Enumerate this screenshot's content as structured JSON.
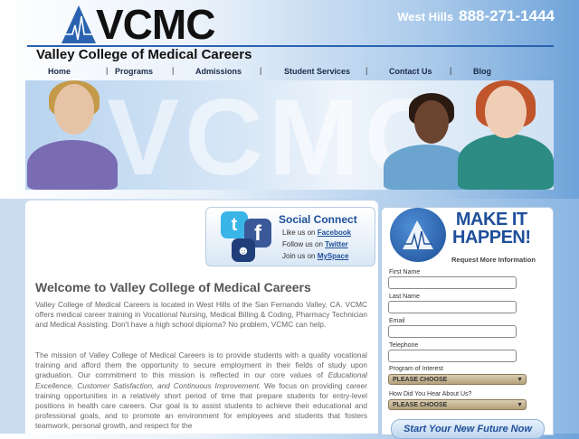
{
  "header": {
    "logo_text": "VCMC",
    "school_name": "Valley College of Medical Careers",
    "phone_location": "West Hills",
    "phone_number": "888-271-1444"
  },
  "nav": {
    "items": [
      "Home",
      "Programs",
      "Admissions",
      "Student Services",
      "Contact Us",
      "Blog"
    ],
    "separator": "|"
  },
  "hero": {
    "watermark": "VCMC"
  },
  "social": {
    "title": "Social Connect",
    "lines": [
      {
        "prefix": "Like us on",
        "link": "Facebook"
      },
      {
        "prefix": "Follow us on",
        "link": "Twitter"
      },
      {
        "prefix": "Join us on",
        "link": "MySpace"
      }
    ]
  },
  "main": {
    "heading": "Welcome to Valley College of Medical Careers",
    "para1": "Valley College of Medical Careers is located in West Hills of the San Fernando Valley, CA. VCMC offers medical career training in Vocational Nursing, Medical Billing & Coding, Pharmacy Technician and Medical Assisting. Don't have a high school diploma? No problem, VCMC can help.",
    "para2_start": "The mission of Valley College of Medical Careers is to provide students with a quality vocational training and afford them the opportunity to secure employment in their fields of study upon graduation.  Our commitment to this mission is reflected in our core values of ",
    "para2_values": "Educational Excellence, Customer Satisfaction, and Continuous Improvement.",
    "para2_end": " We focus on providing career training opportunities in a relatively short period of time that prepare students for entry-level positions in health care careers.  Our goal is to assist students to achieve their educational and professional goals, and to promote an environment for employees and students that fosters teamwork, personal growth, and respect for the"
  },
  "form": {
    "title_line1": "MAKE IT",
    "title_line2": "HAPPEN!",
    "subtitle": "Request More Information",
    "fields": [
      "First Name",
      "Last Name",
      "Email",
      "Telephone"
    ],
    "program_label": "Program of Interest",
    "program_value": "PLEASE CHOOSE",
    "heard_label": "How Did You Hear About Us?",
    "heard_value": "PLEASE CHOOSE",
    "submit_label": "Start Your New Future Now"
  }
}
